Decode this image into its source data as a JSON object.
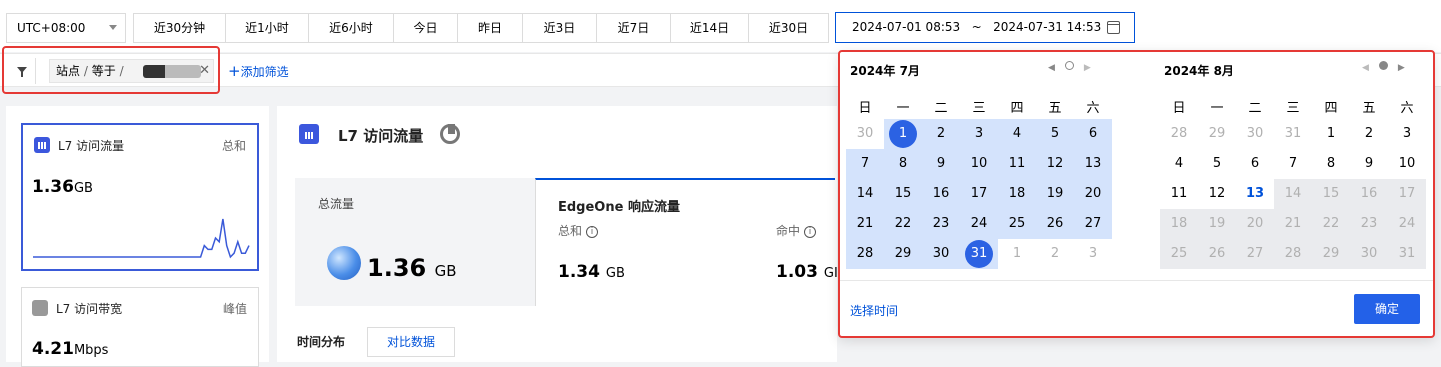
{
  "timezone": "UTC+08:00",
  "quick_ranges": [
    "近30分钟",
    "近1小时",
    "近6小时",
    "今日",
    "昨日",
    "近3日",
    "近7日",
    "近14日",
    "近30日"
  ],
  "date_range": {
    "start": "2024-07-01 08:53",
    "separator": "~",
    "end": "2024-07-31 14:53"
  },
  "filter": {
    "field": "站点",
    "sep1": "/",
    "op": "等于",
    "sep2": "/",
    "add_label": "添加筛选"
  },
  "cards": [
    {
      "title": "L7 访问流量",
      "agg": "总和",
      "value": "1.36",
      "unit": "GB"
    },
    {
      "title": "L7 访问带宽",
      "agg": "峰值",
      "value": "4.21",
      "unit": "Mbps"
    }
  ],
  "sparkline": [
    0,
    0,
    0,
    0,
    0,
    0,
    0,
    0,
    0,
    0,
    0,
    0,
    0,
    0,
    0,
    0,
    0,
    0,
    0,
    0,
    0,
    0,
    0,
    0,
    0,
    0,
    0,
    0,
    0,
    0,
    0,
    0,
    0,
    0,
    0,
    0,
    0,
    0,
    0,
    0,
    0,
    0,
    0,
    0,
    0,
    0,
    0.3,
    0.2,
    0.2,
    0.5,
    0.4,
    1.0,
    0.3,
    0.0,
    0.1,
    0.4,
    0.1,
    0.1,
    0.3
  ],
  "main": {
    "title": "L7 访问流量",
    "total_label": "总流量",
    "total_value": "1.36",
    "total_unit": "GB",
    "edge_title": "EdgeOne 响应流量",
    "sum_label": "总和",
    "sum_value": "1.34",
    "sum_unit": "GB",
    "hit_label": "命中",
    "hit_value": "1.03",
    "hit_unit": "GI",
    "time_dist_label": "时间分布",
    "compare_label": "对比数据"
  },
  "picker": {
    "left_title": "2024年 7月",
    "right_title": "2024年 8月",
    "weekdays": [
      "日",
      "一",
      "二",
      "三",
      "四",
      "五",
      "六"
    ],
    "left_days": [
      [
        "30",
        "1",
        "2",
        "3",
        "4",
        "5",
        "6"
      ],
      [
        "7",
        "8",
        "9",
        "10",
        "11",
        "12",
        "13"
      ],
      [
        "14",
        "15",
        "16",
        "17",
        "18",
        "19",
        "20"
      ],
      [
        "21",
        "22",
        "23",
        "24",
        "25",
        "26",
        "27"
      ],
      [
        "28",
        "29",
        "30",
        "31",
        "1",
        "2",
        "3"
      ]
    ],
    "right_days": [
      [
        "28",
        "29",
        "30",
        "31",
        "1",
        "2",
        "3"
      ],
      [
        "4",
        "5",
        "6",
        "7",
        "8",
        "9",
        "10"
      ],
      [
        "11",
        "12",
        "13",
        "14",
        "15",
        "16",
        "17"
      ],
      [
        "18",
        "19",
        "20",
        "21",
        "22",
        "23",
        "24"
      ],
      [
        "25",
        "26",
        "27",
        "28",
        "29",
        "30",
        "31"
      ]
    ],
    "select_time_label": "选择时间",
    "confirm_label": "确定",
    "prev_icon": "◀",
    "next_icon": "▶"
  }
}
